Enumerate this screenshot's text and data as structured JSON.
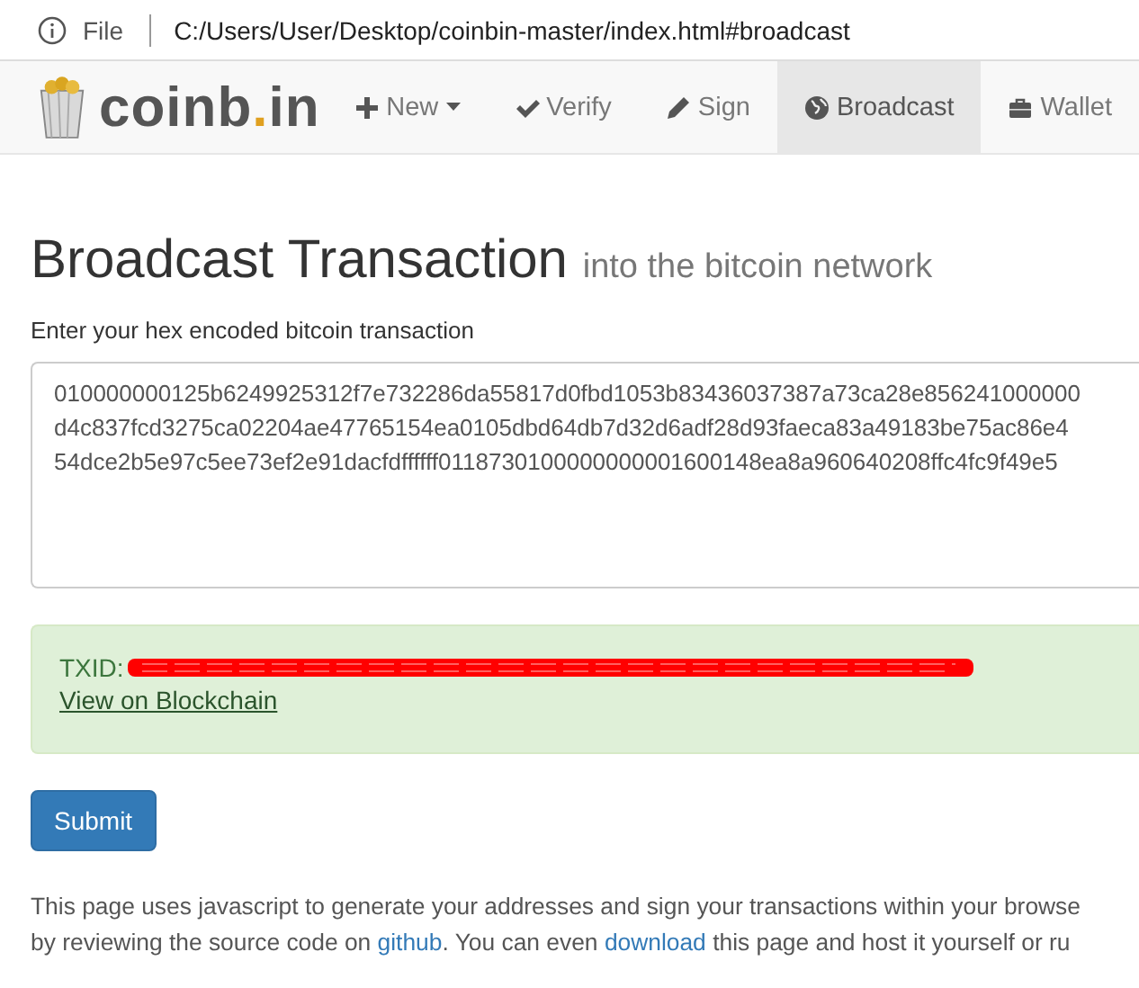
{
  "address_bar": {
    "scheme": "File",
    "url": "C:/Users/User/Desktop/coinbin-master/index.html#broadcast"
  },
  "brand": {
    "name": "coinb",
    "dot": ".",
    "tld": "in"
  },
  "nav": [
    {
      "kind": "plus",
      "label": "New",
      "dropdown": true,
      "selected": false
    },
    {
      "kind": "check",
      "label": "Verify",
      "dropdown": false,
      "selected": false
    },
    {
      "kind": "pencil",
      "label": "Sign",
      "dropdown": false,
      "selected": false
    },
    {
      "kind": "globe",
      "label": "Broadcast",
      "dropdown": false,
      "selected": true
    },
    {
      "kind": "briefcase",
      "label": "Wallet",
      "dropdown": false,
      "selected": false
    }
  ],
  "heading": {
    "title": "Broadcast Transaction",
    "subtitle": "into the bitcoin network"
  },
  "field_label": "Enter your hex encoded bitcoin transaction",
  "transaction_lines": [
    "010000000125b6249925312f7e732286da55817d0fbd1053b83436037387a73ca28e856241000000",
    "d4c837fcd3275ca02204ae47765154ea0105dbd64db7d32d6adf28d93faeca83a49183be75ac86e4",
    "54dce2b5e97c5ee73ef2e91dacfdffffff0118730100000000001600148ea8a960640208ffc4fc9f49e5"
  ],
  "result": {
    "txid_label": "TXID:",
    "txid_redacted": true,
    "link": "View on Blockchain"
  },
  "submit": "Submit",
  "footer": [
    [
      "This page uses javascript to generate your addresses and sign your transactions within your browse"
    ],
    [
      "by reviewing the source code on ",
      {
        "link": "github"
      },
      ". You can even ",
      {
        "link": "download"
      },
      " this page and host it yourself or ru"
    ]
  ]
}
